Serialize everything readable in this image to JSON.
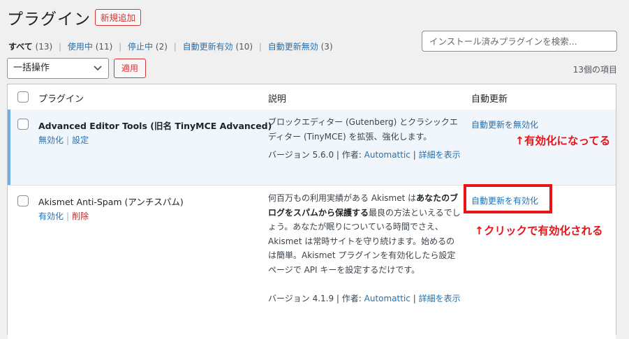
{
  "header": {
    "title": "プラグイン",
    "add_new": "新規追加"
  },
  "filters": [
    {
      "label": "すべて",
      "count": "(13)"
    },
    {
      "label": "使用中",
      "count": "(11)"
    },
    {
      "label": "停止中",
      "count": "(2)"
    },
    {
      "label": "自動更新有効",
      "count": "(10)"
    },
    {
      "label": "自動更新無効",
      "count": "(3)"
    }
  ],
  "search": {
    "placeholder": "インストール済みプラグインを検索..."
  },
  "bulk": {
    "selected": "一括操作",
    "apply": "適用"
  },
  "item_count": "13個の項目",
  "table": {
    "headers": {
      "plugin": "プラグイン",
      "description": "説明",
      "auto_update": "自動更新"
    },
    "rows": [
      {
        "name": "Advanced Editor Tools (旧名 TinyMCE Advanced)",
        "actions": [
          "無効化",
          "設定"
        ],
        "description": "ブロックエディター (Gutenberg) とクラシックエディター (TinyMCE) を拡張、強化します。",
        "version": "バージョン 5.6.0",
        "author_label": "作者:",
        "author": "Automattic",
        "details": "詳細を表示",
        "auto_update": "自動更新を無効化"
      },
      {
        "name": "Akismet Anti-Spam (アンチスパム)",
        "actions": [
          "有効化",
          "削除"
        ],
        "description_pre": "何百万もの利用実績がある Akismet は",
        "description_bold": "あなたのブログをスパムから保護する",
        "description_post": "最良の方法といえるでしょう。あなたが眠りについている時間でさえ、Akismet は常時サイトを守り続けます。始めるのは簡単。Akismet プラグインを有効化したら設定ページで API キーを設定するだけです。",
        "version": "バージョン 4.1.9",
        "author_label": "作者:",
        "author": "Automattic",
        "details": "詳細を表示",
        "auto_update": "自動更新を有効化"
      }
    ]
  },
  "annotations": {
    "note1": "↑有効化になってる",
    "note2": "↑クリックで有効化される",
    "color": "#e8141a"
  }
}
